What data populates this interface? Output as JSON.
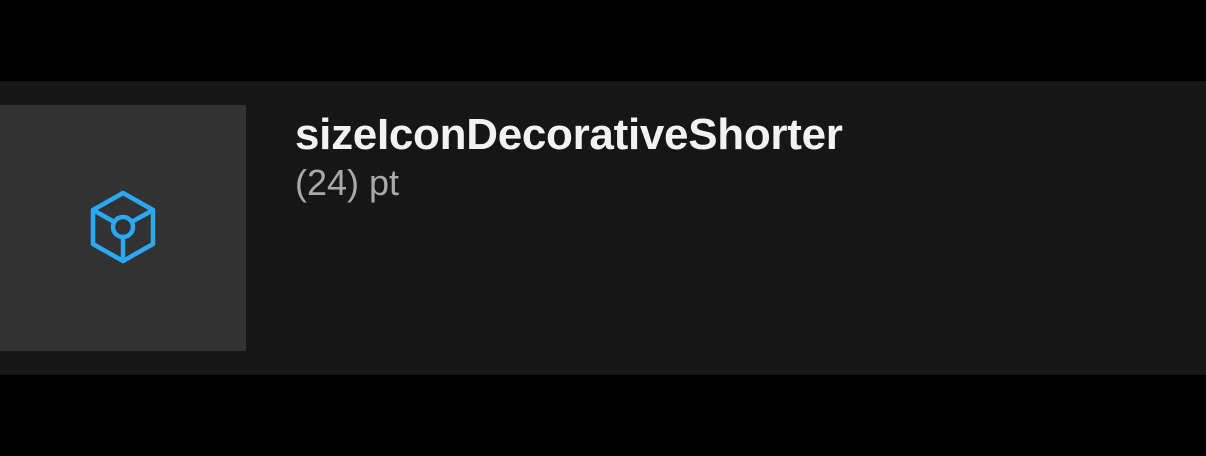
{
  "token": {
    "name": "sizeIconDecorativeShorter",
    "value": "(24) pt",
    "icon": "cube-icon",
    "icon_color": "#2aa9f2"
  }
}
